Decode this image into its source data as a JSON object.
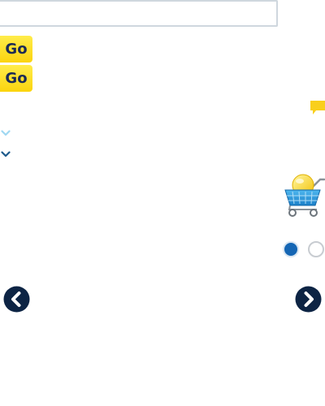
{
  "search": {
    "placeholder": "",
    "value": ""
  },
  "buttons": {
    "go_primary": "Go",
    "go_secondary": "Go"
  },
  "icons": {
    "chat": "chat-bubble-icon",
    "chevron_light": "chevron-down-icon",
    "chevron_dark": "chevron-down-icon",
    "cart": "shopping-cart-icon",
    "prev": "arrow-left-icon",
    "next": "arrow-right-icon"
  },
  "carousel": {
    "slide_count": 2,
    "active_slide": 1
  },
  "colors": {
    "button_yellow": "#fbd40e",
    "button_text": "#1a2a55",
    "accent_blue": "#1566b4",
    "nav_navy": "#0d2444",
    "chat_yellow": "#f9cf1c",
    "chevron_light": "#9fd8f2",
    "chevron_dark": "#1d5a8c"
  }
}
